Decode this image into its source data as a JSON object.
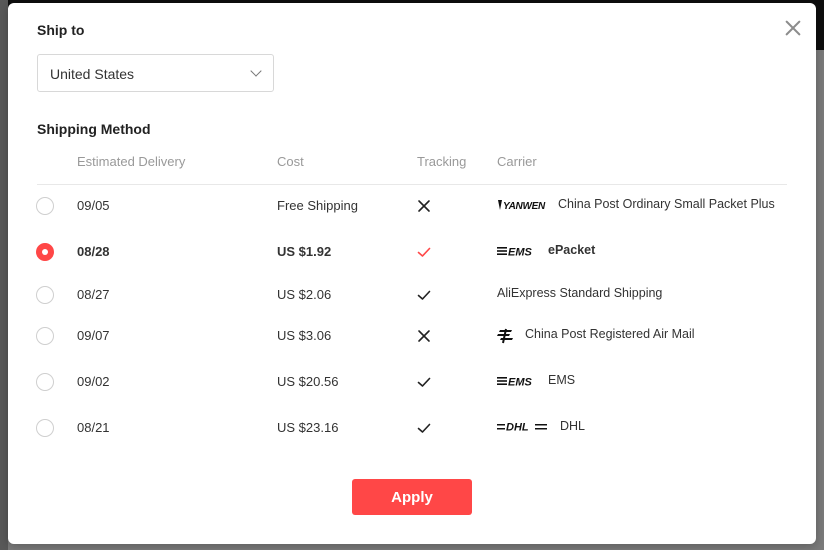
{
  "ship_to": {
    "title": "Ship to",
    "country": "United States"
  },
  "shipping_method": {
    "title": "Shipping Method",
    "headers": {
      "delivery": "Estimated Delivery",
      "cost": "Cost",
      "tracking": "Tracking",
      "carrier": "Carrier"
    },
    "options": [
      {
        "date": "09/05",
        "cost": "Free Shipping",
        "tracking": "no",
        "logo": "yanwen-logo",
        "logo_text": "YANWEN",
        "carrier": "China Post Ordinary Small Packet Plus",
        "selected": false
      },
      {
        "date": "08/28",
        "cost": "US $1.92",
        "tracking": "yes",
        "logo": "ems-logo",
        "logo_text": "EMS",
        "carrier": "ePacket",
        "selected": true
      },
      {
        "date": "08/27",
        "cost": "US $2.06",
        "tracking": "yes",
        "logo": "",
        "logo_text": "",
        "carrier": "AliExpress Standard Shipping",
        "selected": false
      },
      {
        "date": "09/07",
        "cost": "US $3.06",
        "tracking": "no",
        "logo": "china-post-logo",
        "logo_text": "",
        "carrier": "China Post Registered Air Mail",
        "selected": false
      },
      {
        "date": "09/02",
        "cost": "US $20.56",
        "tracking": "yes",
        "logo": "ems-logo",
        "logo_text": "EMS",
        "carrier": "EMS",
        "selected": false
      },
      {
        "date": "08/21",
        "cost": "US $23.16",
        "tracking": "yes",
        "logo": "dhl-logo",
        "logo_text": "DHL",
        "carrier": "DHL",
        "selected": false
      }
    ]
  },
  "apply_label": "Apply",
  "icons": {
    "close": "close-icon",
    "dropdown": "chevron-down-icon",
    "tracking_yes": "check-icon",
    "tracking_no": "cross-icon"
  },
  "colors": {
    "accent": "#ff4747",
    "text": "#333333",
    "muted": "#999999"
  }
}
